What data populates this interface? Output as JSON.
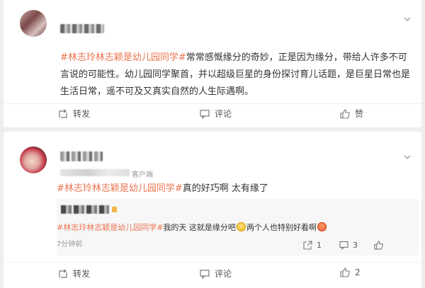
{
  "posts": [
    {
      "topic": "#林志玲林志颖是幼儿园同学#",
      "body": "常常感慨缘分的奇妙，正是因为缘分，带给人许多不可言说的可能性。幼儿园同学聚首，并以超级巨星的身份探讨育儿话题，是巨星日常也是生活日常，遥不可及又真实自然的人生际遇啊。",
      "actions": {
        "repost": "转发",
        "comment": "评论",
        "like": "赞"
      }
    },
    {
      "client": "客户端",
      "topic": "#林志玲林志颖是幼儿园同学#",
      "body": "真的好巧啊 太有缘了",
      "reply": {
        "topic": "#林志玲林志颖是幼儿园同学#",
        "text_1": "我的天 这就是缘分吧",
        "text_2": "两个人也特别好看啊",
        "time": "7分钟前",
        "repost_count": "1",
        "comment_count": "3"
      },
      "actions": {
        "repost": "转发",
        "comment": "评论",
        "like": "2"
      }
    }
  ],
  "icons": {
    "expand": "chevron-down-icon",
    "repost": "repost-icon",
    "comment": "comment-icon",
    "like": "thumbs-up-icon",
    "reply_share": "share-icon",
    "emoji_1": "emoji-smile-icon",
    "emoji_2": "emoji-laugh-icon"
  },
  "colors": {
    "topic": "#eb7350",
    "background": "#eeeeee",
    "card": "#ffffff",
    "muted": "#999999"
  }
}
